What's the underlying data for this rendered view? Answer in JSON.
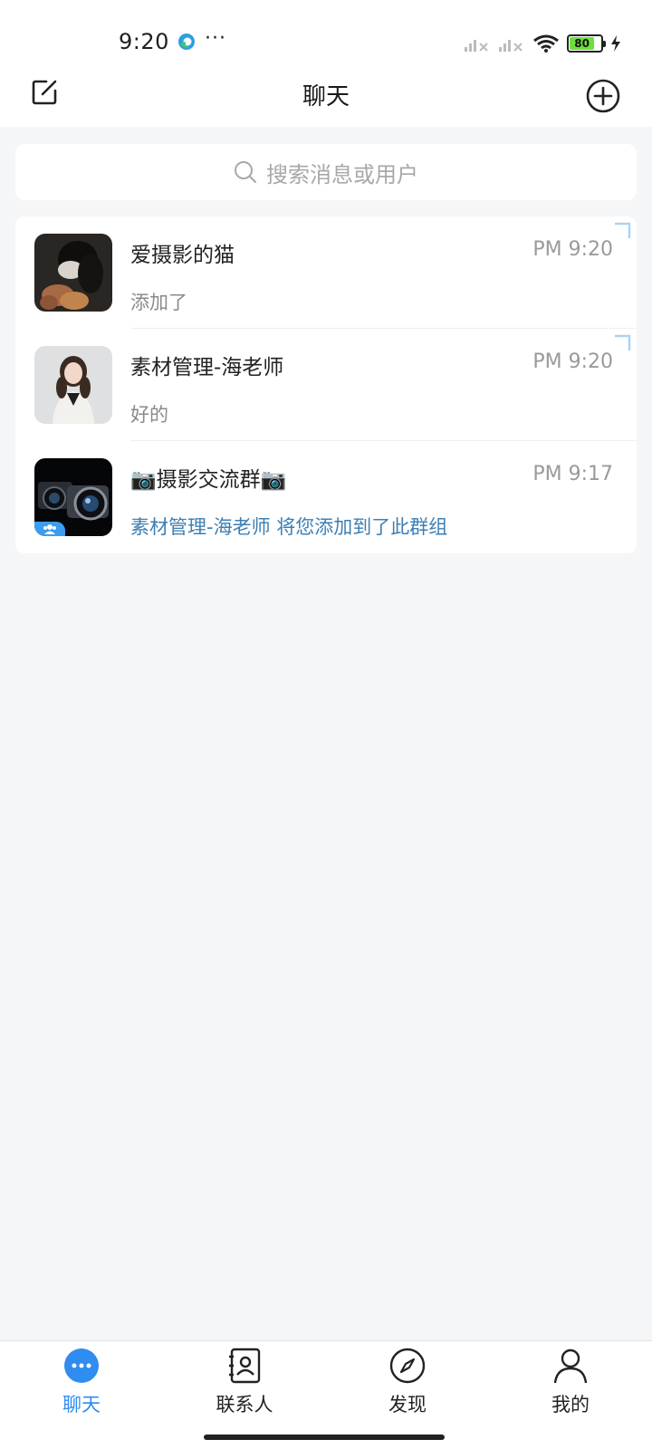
{
  "status_bar": {
    "time": "9:20",
    "battery": "80",
    "icons": [
      "edge-browser-icon",
      "more-dots-icon",
      "signal-icon",
      "signal-icon",
      "wifi-icon",
      "battery-icon",
      "charging-icon"
    ]
  },
  "header": {
    "title": "聊天",
    "left_icon": "compose-icon",
    "right_icon": "add-circle-icon"
  },
  "search": {
    "placeholder": "搜索消息或用户"
  },
  "chats": [
    {
      "name": "爱摄影的猫",
      "time": "PM 9:20",
      "preview": "添加了",
      "pinned": true,
      "group": false
    },
    {
      "name": "素材管理-海老师",
      "time": "PM 9:20",
      "preview": "好的",
      "pinned": true,
      "group": false
    },
    {
      "name": "📷摄影交流群📷",
      "time": "PM 9:17",
      "preview": "素材管理-海老师 将您添加到了此群组",
      "pinned": false,
      "group": true
    }
  ],
  "nav": [
    {
      "label": "聊天",
      "icon": "chat-bubble-icon",
      "active": true
    },
    {
      "label": "联系人",
      "icon": "contacts-icon",
      "active": false
    },
    {
      "label": "发现",
      "icon": "compass-icon",
      "active": false
    },
    {
      "label": "我的",
      "icon": "person-icon",
      "active": false
    }
  ],
  "colors": {
    "accent": "#2f8cf0",
    "background": "#f5f6f8",
    "preview_highlight": "#3d7fb3"
  }
}
